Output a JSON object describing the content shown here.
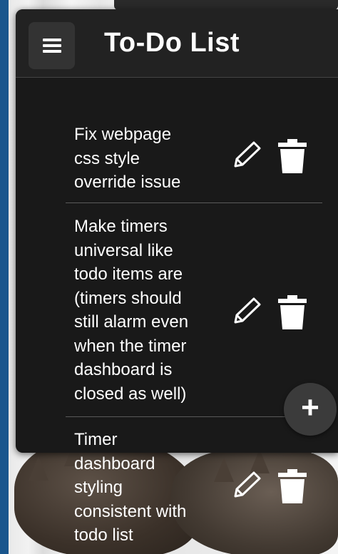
{
  "header": {
    "title": "To-Do List",
    "menu_icon": "hamburger-menu-icon"
  },
  "todos": [
    {
      "text_lines": [
        "Fix webpage",
        "css style",
        "override issue"
      ]
    },
    {
      "text_lines": [
        "Make timers",
        "universal like",
        "todo items are",
        "(timers should",
        "still alarm even",
        "when the timer",
        "dashboard is",
        "closed as well)"
      ]
    },
    {
      "text_lines": [
        "Timer",
        "dashboard",
        "styling",
        "consistent with",
        "todo list"
      ]
    }
  ],
  "item_icons": {
    "edit": "pencil-icon",
    "delete": "trash-icon"
  },
  "fab": {
    "label": "+",
    "icon": "plus-icon"
  },
  "colors": {
    "panel": "#191919",
    "header": "#222222",
    "button": "#333333",
    "text": "#ffffff"
  }
}
